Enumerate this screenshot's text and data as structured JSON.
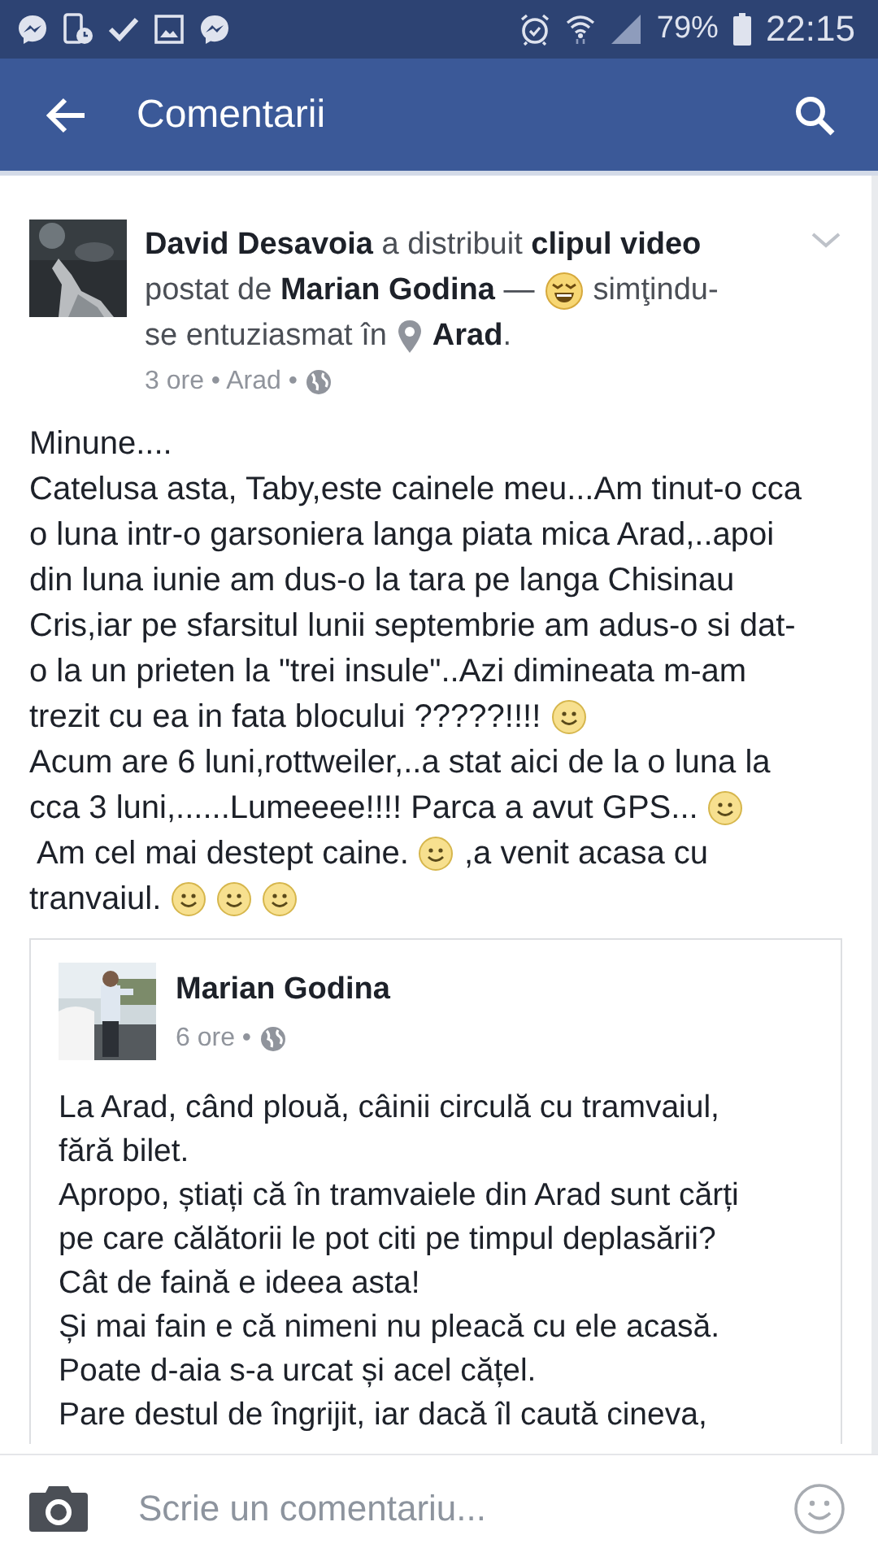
{
  "status_bar": {
    "battery": "79%",
    "time": "22:15"
  },
  "app_bar": {
    "title": "Comentarii"
  },
  "post": {
    "header": [
      [
        {
          "kind": "text",
          "text": "**David Desavoia** a distribuit **clipul video**"
        }
      ],
      [
        {
          "kind": "text",
          "text": "postat de **Marian Godina** —"
        },
        {
          "kind": "starstruck"
        },
        {
          "kind": "text",
          "text": "simţindu-"
        }
      ],
      [
        {
          "kind": "text",
          "text": "se entuziasmat în"
        },
        {
          "kind": "pin"
        },
        {
          "kind": "text",
          "text": "**Arad**."
        }
      ]
    ],
    "meta": "3 ore • Arad •",
    "body": [
      [
        {
          "kind": "text",
          "text": "Minune...."
        }
      ],
      [
        {
          "kind": "text",
          "text": "Catelusa asta, Taby,este cainele meu...Am tinut-o cca"
        }
      ],
      [
        {
          "kind": "text",
          "text": "o luna intr-o garsoniera langa piata mica Arad,..apoi"
        }
      ],
      [
        {
          "kind": "text",
          "text": "din luna iunie am dus-o la tara pe langa Chisinau"
        }
      ],
      [
        {
          "kind": "text",
          "text": "Cris,iar pe sfarsitul lunii septembrie am adus-o si dat-"
        }
      ],
      [
        {
          "kind": "text",
          "text": "o la un prieten la \"trei insule\"..Azi dimineata m-am"
        }
      ],
      [
        {
          "kind": "text",
          "text": "trezit cu ea in fata blocului ?????!!!!"
        },
        {
          "kind": "smiley"
        }
      ],
      [
        {
          "kind": "text",
          "text": "Acum are 6 luni,rottweiler,..a stat aici de la o luna la"
        }
      ],
      [
        {
          "kind": "text",
          "text": "cca 3 luni,......Lumeeee!!!! Parca a avut GPS..."
        },
        {
          "kind": "smiley"
        }
      ],
      [
        {
          "kind": "text",
          "text": " Am cel mai destept caine."
        },
        {
          "kind": "smiley"
        },
        {
          "kind": "text",
          "text": ",a venit acasa cu"
        }
      ],
      [
        {
          "kind": "text",
          "text": "tranvaiul."
        },
        {
          "kind": "smiley"
        },
        {
          "kind": "smiley"
        },
        {
          "kind": "smiley"
        }
      ]
    ],
    "shared": {
      "author": "Marian Godina",
      "meta": "6 ore •",
      "lines": [
        "La Arad, când plouă, câinii circulă cu tramvaiul,",
        "fără bilet.",
        "Apropo, știați că în tramvaiele din Arad sunt cărți",
        "pe care călătorii le pot citi pe timpul deplasării?",
        "Cât de faină e ideea asta!",
        "Și mai fain e că nimeni nu pleacă cu ele acasă.",
        "Poate d-aia s-a urcat și acel cățel.",
        "Pare destul de îngrijit, iar dacă îl caută cineva,"
      ]
    }
  },
  "comment_bar": {
    "placeholder": "Scrie un comentariu..."
  }
}
